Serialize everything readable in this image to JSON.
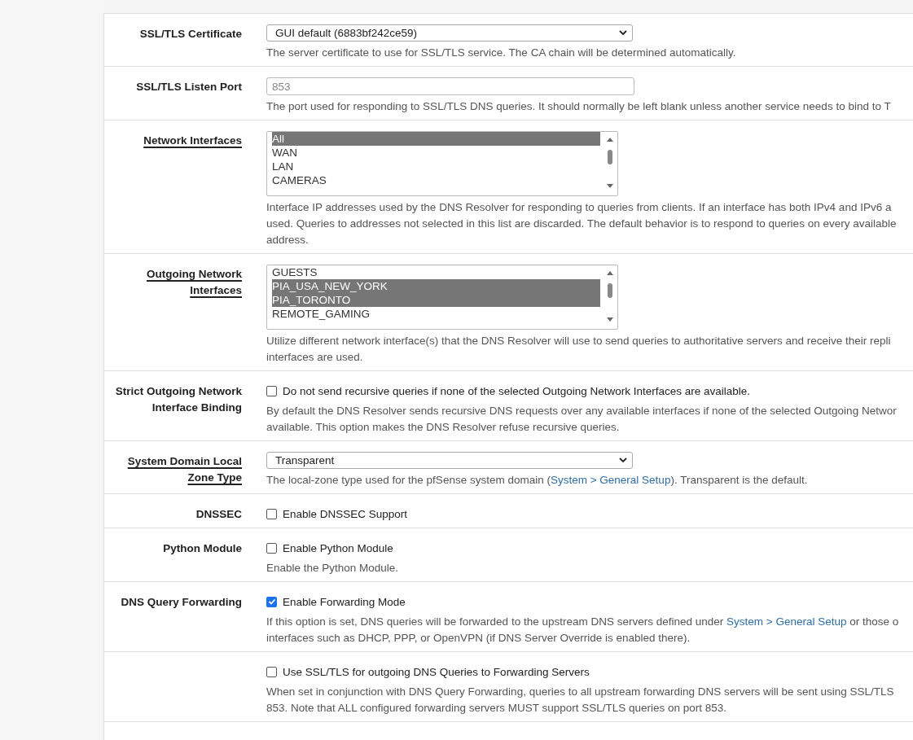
{
  "rows": [
    {
      "label": "SSL/TLS Certificate",
      "underlined": false,
      "kind": "select",
      "value": "GUI default (6883bf242ce59)",
      "help": [
        [
          {
            "kind": "text",
            "text": "The server certificate to use for SSL/TLS service. The CA chain will be determined automatically."
          }
        ]
      ]
    },
    {
      "label": "SSL/TLS Listen Port",
      "underlined": false,
      "kind": "input",
      "placeholder": "853",
      "help": [
        [
          {
            "kind": "text",
            "text": "The port used for responding to SSL/TLS DNS queries. It should normally be left blank unless another service needs to bind to T"
          }
        ]
      ]
    },
    {
      "label": "Network Interfaces",
      "underlined": true,
      "kind": "listbox",
      "options": [
        {
          "text": "All",
          "selected": true
        },
        {
          "text": "WAN",
          "selected": false
        },
        {
          "text": "LAN",
          "selected": false
        },
        {
          "text": "CAMERAS",
          "selected": false
        }
      ],
      "help": [
        [
          {
            "kind": "text",
            "text": "Interface IP addresses used by the DNS Resolver for responding to queries from clients. If an interface has both IPv4 and IPv6 a"
          }
        ],
        [
          {
            "kind": "text",
            "text": "used. Queries to addresses not selected in this list are discarded. The default behavior is to respond to queries on every available"
          }
        ],
        [
          {
            "kind": "text",
            "text": "address."
          }
        ]
      ]
    },
    {
      "label": "Outgoing Network Interfaces",
      "underlined": true,
      "kind": "listbox",
      "options": [
        {
          "text": "GUESTS",
          "selected": false
        },
        {
          "text": "PIA_USA_NEW_YORK",
          "selected": true
        },
        {
          "text": "PIA_TORONTO",
          "selected": true
        },
        {
          "text": "REMOTE_GAMING",
          "selected": false
        }
      ],
      "help": [
        [
          {
            "kind": "text",
            "text": "Utilize different network interface(s) that the DNS Resolver will use to send queries to authoritative servers and receive their repli"
          }
        ],
        [
          {
            "kind": "text",
            "text": "interfaces are used."
          }
        ]
      ]
    },
    {
      "label": "Strict Outgoing Network Interface Binding",
      "underlined": false,
      "kind": "checkbox",
      "checked": false,
      "value": "Do not send recursive queries if none of the selected Outgoing Network Interfaces are available.",
      "help": [
        [
          {
            "kind": "text",
            "text": "By default the DNS Resolver sends recursive DNS requests over any available interfaces if none of the selected Outgoing Networ"
          }
        ],
        [
          {
            "kind": "text",
            "text": "available. This option makes the DNS Resolver refuse recursive queries."
          }
        ]
      ]
    },
    {
      "label": "System Domain Local Zone Type",
      "underlined": true,
      "kind": "select",
      "value": "Transparent",
      "help": [
        [
          {
            "kind": "text",
            "text": "The local-zone type used for the pfSense system domain ("
          },
          {
            "kind": "link",
            "text": "System > General Setup"
          },
          {
            "kind": "text",
            "text": "). Transparent is the default."
          }
        ]
      ]
    },
    {
      "label": "DNSSEC",
      "underlined": false,
      "kind": "checkbox",
      "checked": false,
      "value": "Enable DNSSEC Support"
    },
    {
      "label": "Python Module",
      "underlined": false,
      "kind": "checkbox",
      "checked": false,
      "value": "Enable Python Module",
      "help": [
        [
          {
            "kind": "text",
            "text": "Enable the Python Module."
          }
        ]
      ]
    },
    {
      "label": "DNS Query Forwarding",
      "underlined": false,
      "kind": "checkbox",
      "checked": true,
      "value": "Enable Forwarding Mode",
      "help": [
        [
          {
            "kind": "text",
            "text": "If this option is set, DNS queries will be forwarded to the upstream DNS servers defined under "
          },
          {
            "kind": "link",
            "text": "System > General Setup"
          },
          {
            "kind": "text",
            "text": " or those o"
          }
        ],
        [
          {
            "kind": "text",
            "text": "interfaces such as DHCP, PPP, or OpenVPN (if DNS Server Override is enabled there)."
          }
        ]
      ]
    },
    {
      "kind": "checkbox",
      "checked": false,
      "value": "Use SSL/TLS for outgoing DNS Queries to Forwarding Servers",
      "help": [
        [
          {
            "kind": "text",
            "text": "When set in conjunction with DNS Query Forwarding, queries to all upstream forwarding DNS servers will be sent using SSL/TLS"
          }
        ],
        [
          {
            "kind": "text",
            "text": "853. Note that ALL configured forwarding servers MUST support SSL/TLS queries on port 853."
          }
        ]
      ]
    }
  ]
}
